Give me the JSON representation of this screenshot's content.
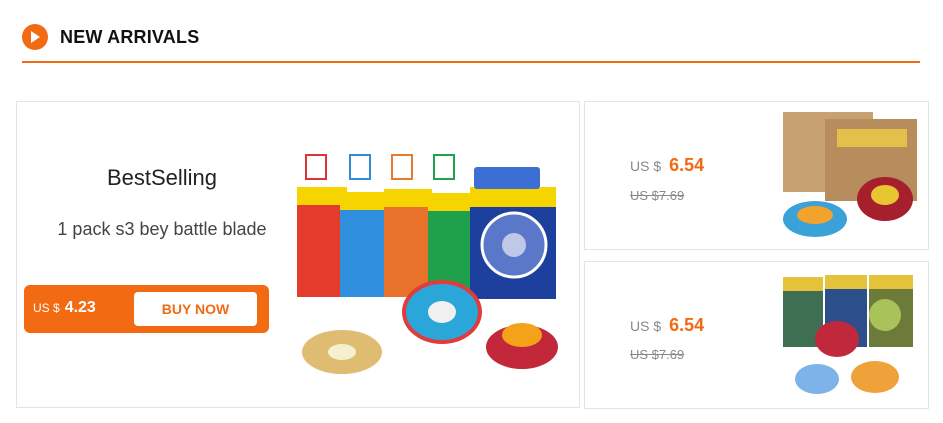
{
  "header": {
    "icon": "play-circle-icon",
    "title": "NEW ARRIVALS",
    "accent_color": "#f26a12"
  },
  "feature": {
    "title": "BestSelling",
    "subtitle": "1 pack s3 bey battle blade",
    "currency": "US $",
    "price": "4.23",
    "buy_label": "BUY NOW",
    "image_icon": "spinning-top-toy-image"
  },
  "products": [
    {
      "currency": "US $",
      "price": "6.54",
      "old_price": "US $7.69",
      "image_icon": "spinning-top-boxes-image"
    },
    {
      "currency": "US $",
      "price": "6.54",
      "old_price": "US $7.69",
      "image_icon": "spinning-top-set-image"
    }
  ]
}
